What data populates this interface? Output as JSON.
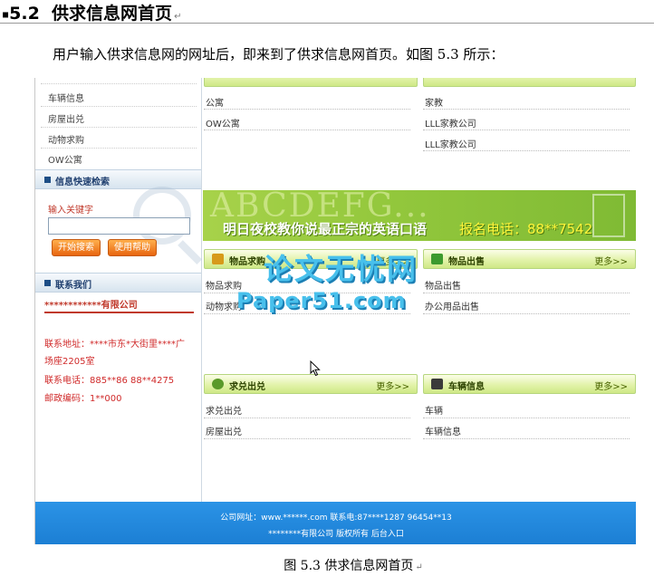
{
  "document": {
    "heading_number": "5.2",
    "heading_text": "供求信息网首页",
    "paragraph": "用户输入供求信息网的网址后，即来到了供求信息网首页。如图 5.3 所示：",
    "caption": "图 5.3 供求信息网首页",
    "paragraph_mark": "↵"
  },
  "page": {
    "sidebar": {
      "top_items": [
        "车辆信息",
        "房屋出兑",
        "动物求购",
        "OW公寓"
      ],
      "search_header": "信息快速检索",
      "keyword_label": "输入关键字",
      "keyword_value": "",
      "search_button": "开始搜索",
      "help_button": "使用帮助",
      "contact_header": "联系我们",
      "company_name": "************有限公司",
      "address_line1": "联系地址：****市东*大街里****广",
      "address_line2": "场座2205室",
      "phone": "联系电话：885**86 88**4275",
      "postcode": "邮政编码：1**000"
    },
    "top_left_list": [
      "公寓",
      "OW公寓"
    ],
    "top_right_list": [
      "家教",
      "LLL家教公司",
      "LLL家教公司"
    ],
    "banner": {
      "headline": "ABCDEFG...",
      "slogan": "明日夜校教你说最正宗的英语口语",
      "phone": "报名电话：88**7542"
    },
    "panels": [
      {
        "title": "物品求购",
        "more": "更多>>",
        "items": [
          "物品求购",
          "动物求购"
        ],
        "icon_color": "#d79a1a"
      },
      {
        "title": "物品出售",
        "more": "更多>>",
        "items": [
          "物品出售",
          "办公用品出售"
        ],
        "icon_color": "#3c9a2e"
      },
      {
        "title": "求兑出兑",
        "more": "更多>>",
        "items": [
          "求兑出兑",
          "房屋出兑"
        ],
        "icon_color": "#5a9a2a"
      },
      {
        "title": "车辆信息",
        "more": "更多>>",
        "items": [
          "车辆",
          "车辆信息"
        ],
        "icon_color": "#3a3a3a"
      }
    ],
    "footer": {
      "line1": "公司网址：www.******.com 联系电:87****1287  96454**13",
      "line2": "********有限公司  版权所有     后台入口"
    }
  },
  "watermark": {
    "chinese": "论文无忧网",
    "english": "Paper51.com"
  },
  "colors": {
    "accent_green": "#cfe886",
    "footer_blue": "#1c7fd4",
    "contact_red": "#d02a2a",
    "button_orange": "#e8650f"
  }
}
